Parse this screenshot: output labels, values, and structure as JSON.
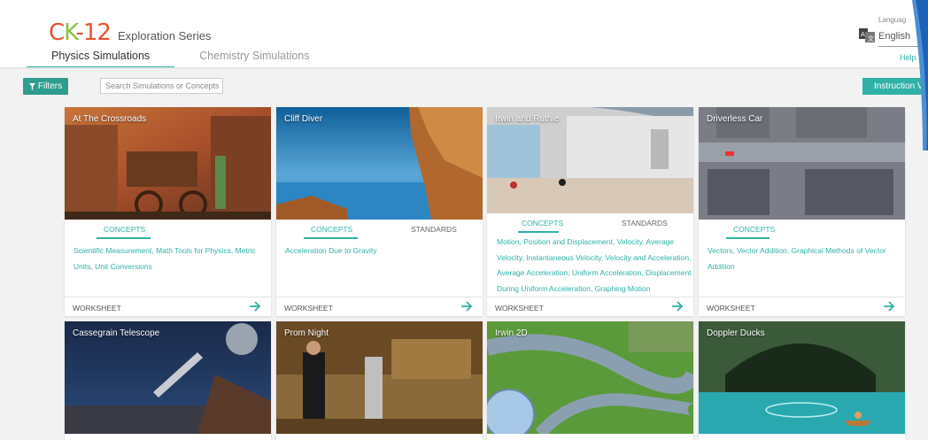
{
  "logo": {
    "c": "C",
    "k": "K",
    "dash": "-",
    "num": "12",
    "series": "Exploration Series"
  },
  "tabs": [
    "Physics Simulations",
    "Chemistry Simulations"
  ],
  "language": {
    "label": "Languag",
    "value": "English"
  },
  "help": "Help",
  "toolbar": {
    "filters": "Filters",
    "search_placeholder": "Search Simulations or Concepts",
    "instructions": "Instruction V"
  },
  "labels": {
    "concepts": "CONCEPTS",
    "standards": "STANDARDS",
    "worksheet": "WORKSHEET"
  },
  "cards": [
    {
      "title": "At The Crossroads",
      "concepts": [
        "Scientific Measurement, Math Tools for Physics, Metric",
        "Units, Unit Conversions"
      ]
    },
    {
      "title": "Cliff Diver",
      "concepts": [
        "Acceleration Due to Gravity"
      ]
    },
    {
      "title": "Irwin and Ruthie",
      "concepts": [
        "Motion, Position and Displacement, Velocity, Average",
        "Velocity, Instantaneous Velocity, Velocity and Acceleration,",
        "Average Acceleration, Uniform Acceleration, Displacement",
        "During Uniform Acceleration, Graphing Motion"
      ]
    },
    {
      "title": "Driverless Car",
      "concepts": [
        "Vectors, Vector Addition, Graphical Methods of Vector",
        "Addition"
      ]
    },
    {
      "title": "Cassegrain Telescope"
    },
    {
      "title": "Prom Night"
    },
    {
      "title": "Irwin 2D"
    },
    {
      "title": "Doppler Ducks"
    }
  ],
  "colors": {
    "accent": "#2fb1a7",
    "filters_bg": "#2e9d8e"
  }
}
